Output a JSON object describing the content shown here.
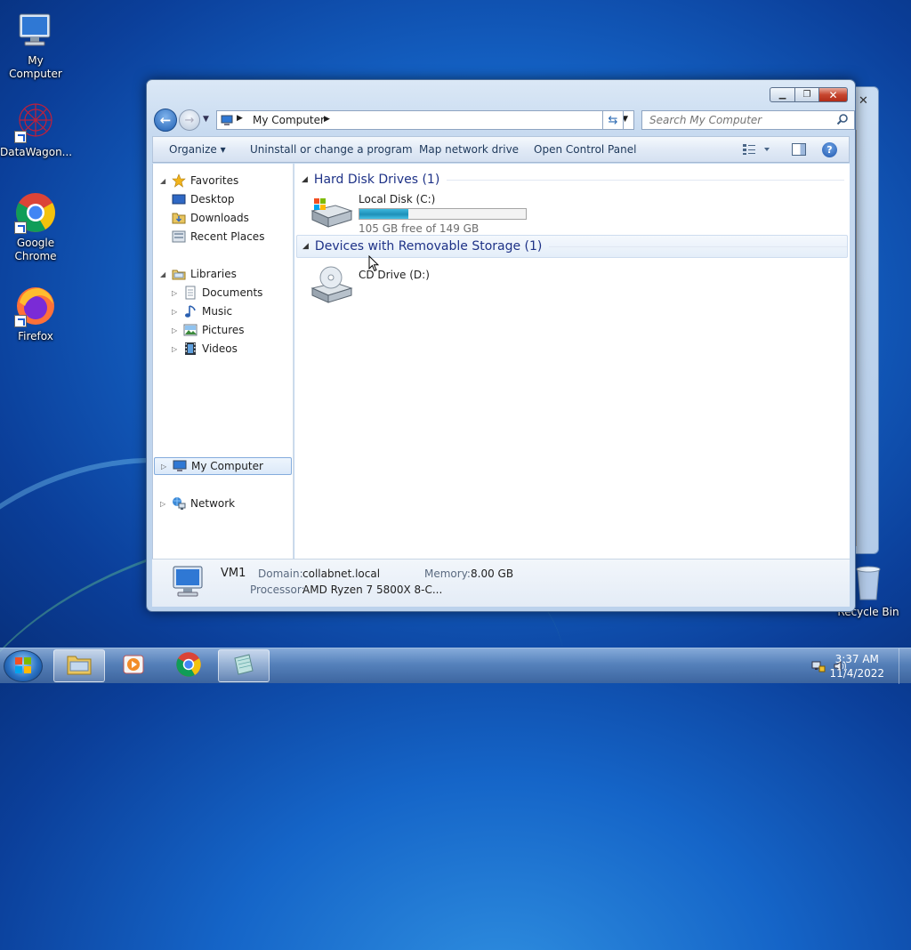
{
  "desktop": {
    "icons": [
      {
        "label": "My Computer"
      },
      {
        "label": "DataWagon..."
      },
      {
        "label": "Google Chrome"
      },
      {
        "label": "Firefox"
      },
      {
        "label": "Recycle Bin"
      }
    ]
  },
  "window": {
    "caption_buttons": {
      "minimize": "minimize",
      "maximize": "maximize",
      "close": "close"
    },
    "address": {
      "crumb": "My Computer"
    },
    "search": {
      "placeholder": "Search My Computer"
    },
    "commands": {
      "organize": "Organize ▾",
      "uninstall": "Uninstall or change a program",
      "map_drive": "Map network drive",
      "control_panel": "Open Control Panel"
    },
    "nav": {
      "favorites": {
        "label": "Favorites",
        "items": [
          "Desktop",
          "Downloads",
          "Recent Places"
        ]
      },
      "libraries": {
        "label": "Libraries",
        "items": [
          "Documents",
          "Music",
          "Pictures",
          "Videos"
        ]
      },
      "computer": "My Computer",
      "network": "Network"
    },
    "groups": {
      "hard_disks": {
        "title": "Hard Disk Drives (1)",
        "drives": [
          {
            "name": "Local Disk (C:)",
            "free_text": "105 GB free of 149 GB",
            "used_fraction": 0.295
          }
        ]
      },
      "removable": {
        "title": "Devices with Removable Storage (1)",
        "drives": [
          {
            "name": "CD Drive (D:)"
          }
        ]
      }
    },
    "details": {
      "computer_name": "VM1",
      "domain_label": "Domain:",
      "domain_value": "collabnet.local",
      "memory_label": "Memory:",
      "memory_value": "8.00 GB",
      "processor_label": "Processor:",
      "processor_value": "AMD Ryzen 7 5800X 8-C..."
    }
  },
  "taskbar": {
    "clock_time": "3:37 AM",
    "clock_date": "11/4/2022"
  },
  "colors": {
    "accent": "#1e3287",
    "usage_fill": "#1e8fb8",
    "close_button": "#c7462f"
  }
}
